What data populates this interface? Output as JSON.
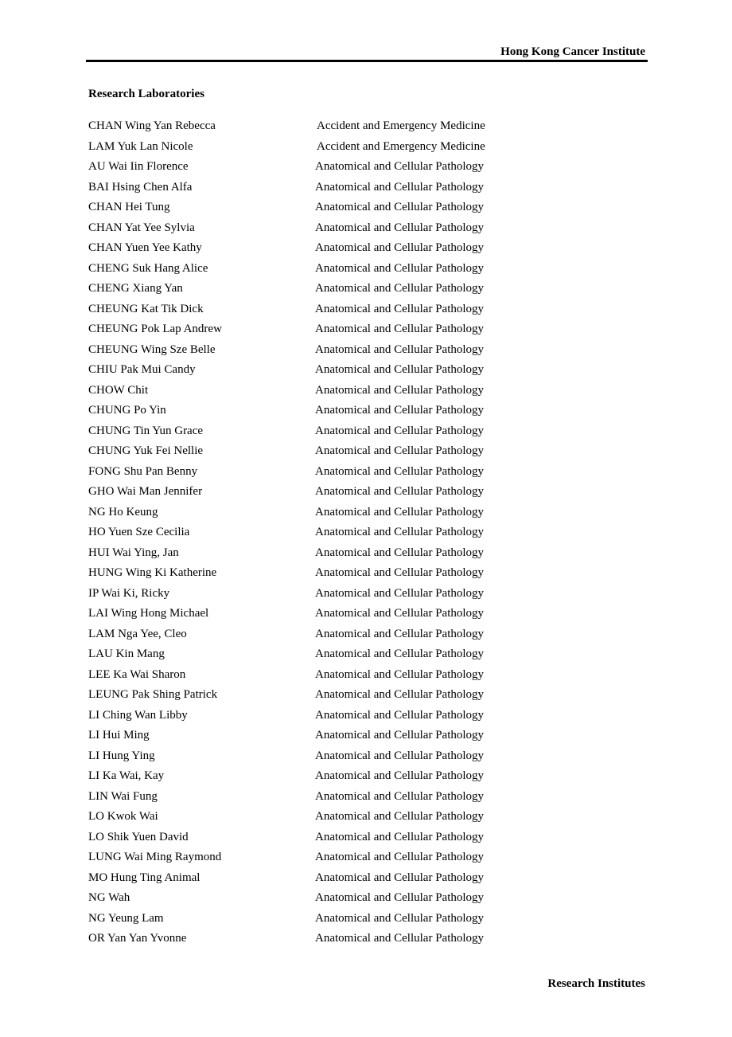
{
  "header": {
    "title": "Hong Kong Cancer Institute"
  },
  "section": {
    "title": "Research Laboratories"
  },
  "entries": [
    {
      "name": "CHAN Wing Yan Rebecca",
      "department": "Accident and Emergency Medicine"
    },
    {
      "name": "LAM Yuk Lan Nicole",
      "department": "Accident and Emergency Medicine"
    },
    {
      "name": "AU Wai Iin Florence",
      "department": "Anatomical and Cellular Pathology"
    },
    {
      "name": "BAI Hsing Chen Alfa",
      "department": "Anatomical and Cellular Pathology"
    },
    {
      "name": "CHAN Hei Tung",
      "department": "Anatomical and Cellular Pathology"
    },
    {
      "name": "CHAN Yat Yee Sylvia",
      "department": "Anatomical and Cellular Pathology"
    },
    {
      "name": "CHAN Yuen Yee Kathy",
      "department": "Anatomical and Cellular Pathology"
    },
    {
      "name": "CHENG Suk Hang Alice",
      "department": "Anatomical and Cellular Pathology"
    },
    {
      "name": "CHENG Xiang Yan",
      "department": "Anatomical and Cellular Pathology"
    },
    {
      "name": "CHEUNG Kat Tik Dick",
      "department": "Anatomical and Cellular Pathology"
    },
    {
      "name": "CHEUNG Pok Lap Andrew",
      "department": "Anatomical and Cellular Pathology"
    },
    {
      "name": "CHEUNG Wing Sze Belle",
      "department": "Anatomical and Cellular Pathology"
    },
    {
      "name": "CHIU Pak Mui Candy",
      "department": "Anatomical and Cellular Pathology"
    },
    {
      "name": "CHOW Chit",
      "department": "Anatomical and Cellular Pathology"
    },
    {
      "name": "CHUNG Po Yin",
      "department": "Anatomical and Cellular Pathology"
    },
    {
      "name": "CHUNG Tin Yun Grace",
      "department": "Anatomical and Cellular Pathology"
    },
    {
      "name": "CHUNG Yuk Fei Nellie",
      "department": "Anatomical and Cellular Pathology"
    },
    {
      "name": "FONG Shu Pan Benny",
      "department": "Anatomical and Cellular Pathology"
    },
    {
      "name": "GHO Wai Man Jennifer",
      "department": "Anatomical and Cellular Pathology"
    },
    {
      "name": "NG Ho Keung",
      "department": "Anatomical and Cellular Pathology"
    },
    {
      "name": "HO Yuen Sze Cecilia",
      "department": "Anatomical and Cellular Pathology"
    },
    {
      "name": "HUI Wai Ying, Jan",
      "department": "Anatomical and Cellular Pathology"
    },
    {
      "name": "HUNG Wing Ki Katherine",
      "department": "Anatomical and Cellular Pathology"
    },
    {
      "name": "IP Wai Ki, Ricky",
      "department": "Anatomical and Cellular Pathology"
    },
    {
      "name": "LAI Wing Hong Michael",
      "department": "Anatomical and Cellular Pathology"
    },
    {
      "name": "LAM Nga Yee, Cleo",
      "department": "Anatomical and Cellular Pathology"
    },
    {
      "name": "LAU Kin Mang",
      "department": "Anatomical and Cellular Pathology"
    },
    {
      "name": "LEE Ka Wai Sharon",
      "department": "Anatomical and Cellular Pathology"
    },
    {
      "name": "LEUNG Pak Shing Patrick",
      "department": "Anatomical and Cellular Pathology"
    },
    {
      "name": "LI Ching Wan Libby",
      "department": "Anatomical and Cellular Pathology"
    },
    {
      "name": "LI Hui Ming",
      "department": "Anatomical and Cellular Pathology"
    },
    {
      "name": "LI Hung Ying",
      "department": "Anatomical and Cellular Pathology"
    },
    {
      "name": "LI Ka Wai, Kay",
      "department": "Anatomical and Cellular Pathology"
    },
    {
      "name": "LIN Wai Fung",
      "department": "Anatomical and Cellular Pathology"
    },
    {
      "name": "LO Kwok Wai",
      "department": "Anatomical and Cellular Pathology"
    },
    {
      "name": "LO Shik Yuen David",
      "department": "Anatomical and Cellular Pathology"
    },
    {
      "name": "LUNG Wai Ming Raymond",
      "department": "Anatomical and Cellular Pathology"
    },
    {
      "name": "MO Hung Ting Animal",
      "department": "Anatomical and Cellular Pathology"
    },
    {
      "name": "NG Wah",
      "department": "Anatomical and Cellular Pathology"
    },
    {
      "name": "NG Yeung Lam",
      "department": "Anatomical and Cellular Pathology"
    },
    {
      "name": "OR Yan Yan Yvonne",
      "department": "Anatomical and Cellular Pathology"
    }
  ],
  "footer": {
    "title": "Research Institutes"
  }
}
